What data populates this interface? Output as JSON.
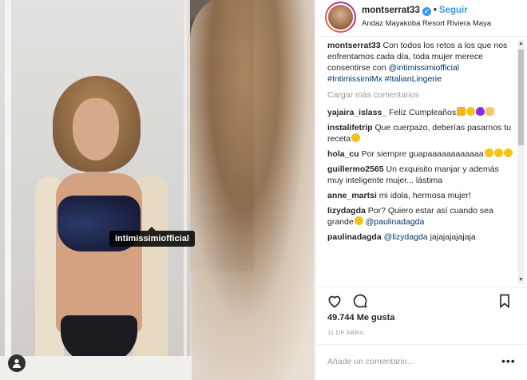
{
  "post": {
    "username": "montserrat33",
    "verified_icon": "verified-badge-icon",
    "separator": "•",
    "follow_label": "Seguir",
    "location": "Andaz Mayakoba Resort Riviera Maya",
    "image_tag": "intimissimiofficial"
  },
  "caption": {
    "username": "montserrat33",
    "text": "Con todos los retos a los que nos enfrentamos cada día, toda mujer merece consentirse con",
    "mention": "@intimissimiofficial",
    "hashtags": "#IntimissimiMx #ItalianLingerie"
  },
  "load_more_label": "Cargar más comentarios",
  "comments": [
    {
      "user": "yajaira_islass_",
      "text": "Feliz Cumpleaños",
      "emojis": [
        "e-box",
        "e-yellow",
        "e-heart",
        "e-hand"
      ]
    },
    {
      "user": "instalifetrip",
      "text": "Que cuerpazo, deberías pasarnos tu receta",
      "emojis": [
        "e-yellow"
      ]
    },
    {
      "user": "hola_cu",
      "text": "Por siempre guapaaaaaaaaaaaa",
      "emojis": [
        "e-yellow",
        "e-yellow",
        "e-yellow"
      ]
    },
    {
      "user": "guillermo2565",
      "text": "Un exquisito manjar y además muy inteligente mujer... lástima",
      "emojis": []
    },
    {
      "user": "anne_martsi",
      "text": "mi idola, hermosa mujer!",
      "emojis": []
    },
    {
      "user": "lizydagda",
      "text": "Por? Quiero estar así cuando sea grande",
      "mention": "@paulinadagda",
      "emojis": [
        "e-yellow"
      ]
    },
    {
      "user": "paulinadagda",
      "text": "",
      "mention": "@lizydagda",
      "suffix": "jajajajajajaja",
      "emojis": []
    }
  ],
  "likes": "49.744 Me gusta",
  "date": "11 DE ABRIL",
  "add_comment_placeholder": "Añade un comentario...",
  "more_options": "•••",
  "colors": {
    "link": "#003569",
    "follow": "#3897f0",
    "muted": "#999999"
  }
}
